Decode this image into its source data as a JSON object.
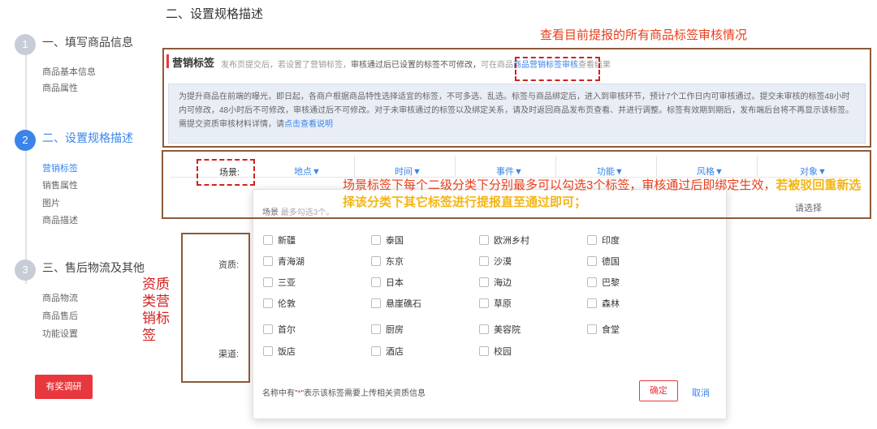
{
  "sidebar": {
    "steps": [
      {
        "num": "1",
        "title": "一、填写商品信息",
        "items": [
          "商品基本信息",
          "商品属性"
        ]
      },
      {
        "num": "2",
        "title": "二、设置规格描述",
        "items": [
          "营销标签",
          "销售属性",
          "图片",
          "商品描述"
        ]
      },
      {
        "num": "3",
        "title": "三、售后物流及其他",
        "items": [
          "商品物流",
          "商品售后",
          "功能设置"
        ]
      }
    ],
    "survey_button": "有奖调研"
  },
  "main": {
    "section_title": "二、设置规格描述",
    "tag_section": {
      "title": "营销标签",
      "hint_a": "发布页提交后，若设置了营销标签，",
      "hint_b": "审核通过后已设置的标签不可修改，",
      "hint_c": "可在商品",
      "hint_link": "商品营销标签审核",
      "hint_d": "查看结果",
      "info_text": "为提升商品在前端的曝光，即日起，各商户根据商品特性选择适宜的标签，不可多选、乱选。标签与商品绑定后，进入到审核环节，预计7个工作日内可审核通过。提交未审核的标签48小时内可修改，48小时后不可修改，审核通过后不可修改。对于未审核通过的标签以及绑定关系，请及时返回商品发布页查看、并进行调整。标签有效期到期后，发布端后台将不再显示该标签。需提交资质审核材料详情，请",
      "info_link": "点击查看说明"
    },
    "filter": {
      "label": "场景:",
      "categories": [
        "地点▼",
        "时间▼",
        "事件▼",
        "功能▼",
        "风格▼",
        "对象▼"
      ]
    },
    "dropdown": {
      "hint_a": "场景",
      "hint_b": "最多勾选3个。",
      "side_text": "请选择",
      "row_label_qual": "资质:",
      "row_label_channel": "渠道:",
      "options": [
        [
          "新疆",
          "泰国",
          "欧洲乡村",
          "印度"
        ],
        [
          "青海湖",
          "东京",
          "沙漠",
          "德国"
        ],
        [
          "三亚",
          "日本",
          "海边",
          "巴黎"
        ],
        [
          "伦敦",
          "悬崖礁石",
          "草原",
          "森林"
        ],
        [
          "首尔",
          "厨房",
          "美容院",
          "食堂"
        ],
        [
          "饭店",
          "酒店",
          "校园"
        ]
      ],
      "footer_a": "名称中有\"",
      "footer_star": "*",
      "footer_b": "\"表示该标签需要上传相关资质信息",
      "confirm": "确定",
      "cancel": "取消"
    }
  },
  "annotations": {
    "top_note": "查看目前提报的所有商品标签审核情况",
    "mid_note_a": "场景标签下每个二级分类下分别最多可以勾选3个标签，审核通过后即绑定生效，",
    "mid_note_b": "若被驳回重新选择该分类下其它标签进行提报直至通过即可；",
    "side_note": "资质类营销标签"
  },
  "colors": {
    "accent_blue": "#3a84ea",
    "accent_red": "#e8383d",
    "annotation_red": "#e83f1c",
    "annotation_yellow": "#f4b514",
    "box_brown": "#8c5a39"
  }
}
